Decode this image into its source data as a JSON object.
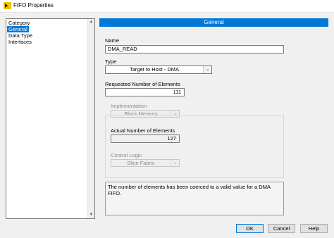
{
  "window": {
    "title": "FIFO Properties",
    "icon": "labview-icon"
  },
  "category": {
    "header": "Category",
    "items": [
      {
        "label": "General",
        "selected": true
      },
      {
        "label": "Data Type",
        "selected": false
      },
      {
        "label": "Interfaces",
        "selected": false
      }
    ]
  },
  "general": {
    "header": "General",
    "name_label": "Name",
    "name_value": "DMA_READ",
    "type_label": "Type",
    "type_value": "Target to Host - DMA",
    "requested_label": "Requested Number of Elements",
    "requested_value": "111",
    "implementation_label": "Implementation",
    "implementation_value": "Block Memory",
    "actual_label": "Actual Number of Elements",
    "actual_value": "127",
    "control_logic_label": "Control Logic",
    "control_logic_value": "Slice Fabric",
    "message": "The number of elements has been coerced to a valid value for a DMA FIFO."
  },
  "buttons": {
    "ok": "OK",
    "cancel": "Cancel",
    "help": "Help"
  },
  "colors": {
    "accent": "#0078d7"
  }
}
